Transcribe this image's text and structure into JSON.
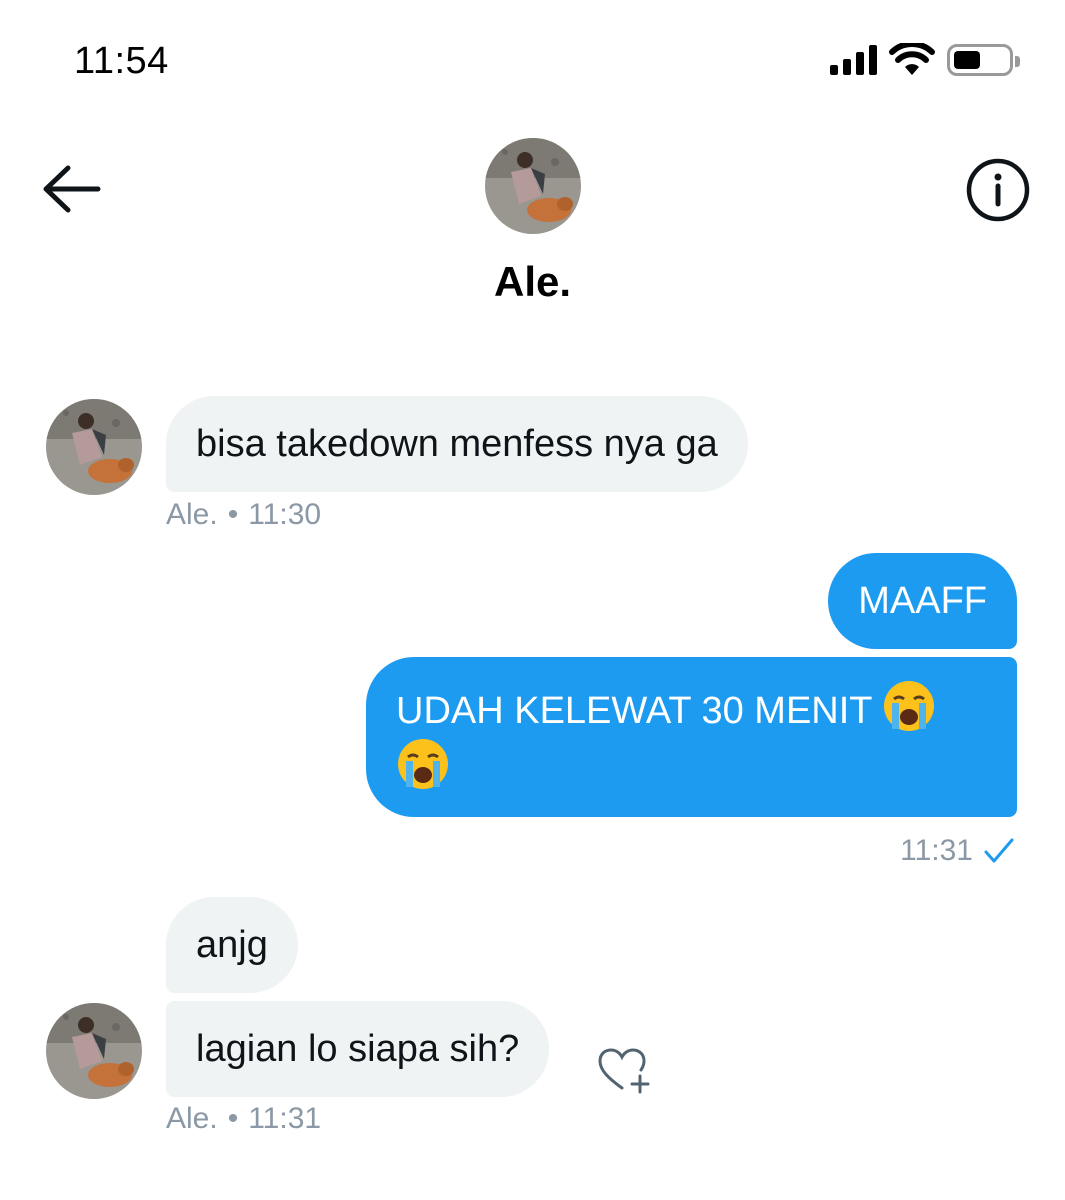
{
  "status_bar": {
    "time": "11:54",
    "icons": [
      "signal-icon",
      "wifi-icon",
      "battery-icon"
    ]
  },
  "header": {
    "contact_name": "Ale.",
    "icons": [
      "back-arrow-icon",
      "info-icon"
    ]
  },
  "messages": [
    {
      "direction": "incoming",
      "text": "bisa takedown menfess nya ga",
      "sender": "Ale.",
      "time": "11:30"
    },
    {
      "direction": "outgoing",
      "text": "MAAFF"
    },
    {
      "direction": "outgoing",
      "text_line1": "UDAH KELEWAT 30 MENIT",
      "emoji": "loudly-crying-face",
      "time": "11:31",
      "status": "read-check"
    },
    {
      "direction": "incoming",
      "text": "anjg"
    },
    {
      "direction": "incoming",
      "text": "lagian lo siapa sih?",
      "sender": "Ale.",
      "time": "11:31"
    }
  ],
  "meta_separator": "•",
  "colors": {
    "outgoing_bubble": "#1d9bf0",
    "incoming_bubble": "#eff3f4",
    "meta_text": "#8b98a5",
    "read_check": "#1d9bf0"
  }
}
